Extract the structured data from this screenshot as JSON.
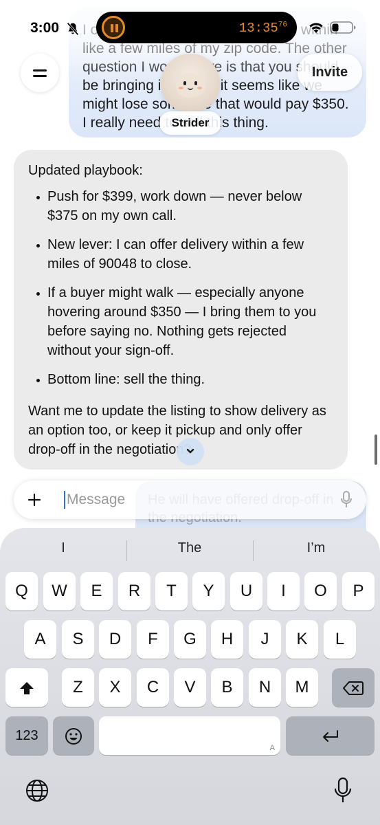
{
  "status_bar": {
    "time": "3:00",
    "island_time": "13:35",
    "island_time_fraction": "76"
  },
  "previous_message": {
    "text": "I only need to sell it as long as it's within like a few miles of my zip code. The other question I would have is that you should be bringing it to me if it seems like we might lose someone that would pay $350. I really need to sell this thing."
  },
  "header": {
    "invite_label": "Invite",
    "agent_name": "Strider"
  },
  "assistant_message": {
    "intro": "Updated playbook:",
    "bullets": [
      "Push for $399, work down — never below $375 on my own call.",
      "New lever: I can offer delivery within a few miles of 90048 to close.",
      "If a buyer might walk — especially anyone hovering around $350 — I bring them to you before saying no. Nothing gets rejected without your sign-off.",
      "Bottom line: sell the thing."
    ],
    "outro": "Want me to update the listing to show delivery as an option too, or keep it pickup and only offer drop-off in the negotiation?"
  },
  "ghost_message": {
    "text": "He will have offered drop-off in the negotiation."
  },
  "composer": {
    "placeholder": "Message"
  },
  "keyboard": {
    "suggestions": [
      "I",
      "The",
      "I’m"
    ],
    "row1": [
      "Q",
      "W",
      "E",
      "R",
      "T",
      "Y",
      "U",
      "I",
      "O",
      "P"
    ],
    "row2": [
      "A",
      "S",
      "D",
      "F",
      "G",
      "H",
      "J",
      "K",
      "L"
    ],
    "row3": [
      "Z",
      "X",
      "C",
      "V",
      "B",
      "N",
      "M"
    ],
    "numbers_label": "123",
    "space_hint": "A"
  },
  "colors": {
    "accent_orange": "#e38b2c",
    "user_bubble": "#dbe6f8",
    "assistant_bubble": "#ebebeb",
    "cursor_blue": "#2f6fe0"
  },
  "icons": {
    "status": [
      "bell-slash-icon",
      "pause-timer-icon",
      "wifi-icon",
      "battery-icon"
    ],
    "header": [
      "menu-icon",
      "avatar"
    ],
    "composer": [
      "plus-icon",
      "microphone-icon"
    ],
    "keyboard": [
      "shift-icon",
      "delete-icon",
      "emoji-icon",
      "return-icon",
      "globe-icon",
      "dictation-icon"
    ]
  }
}
